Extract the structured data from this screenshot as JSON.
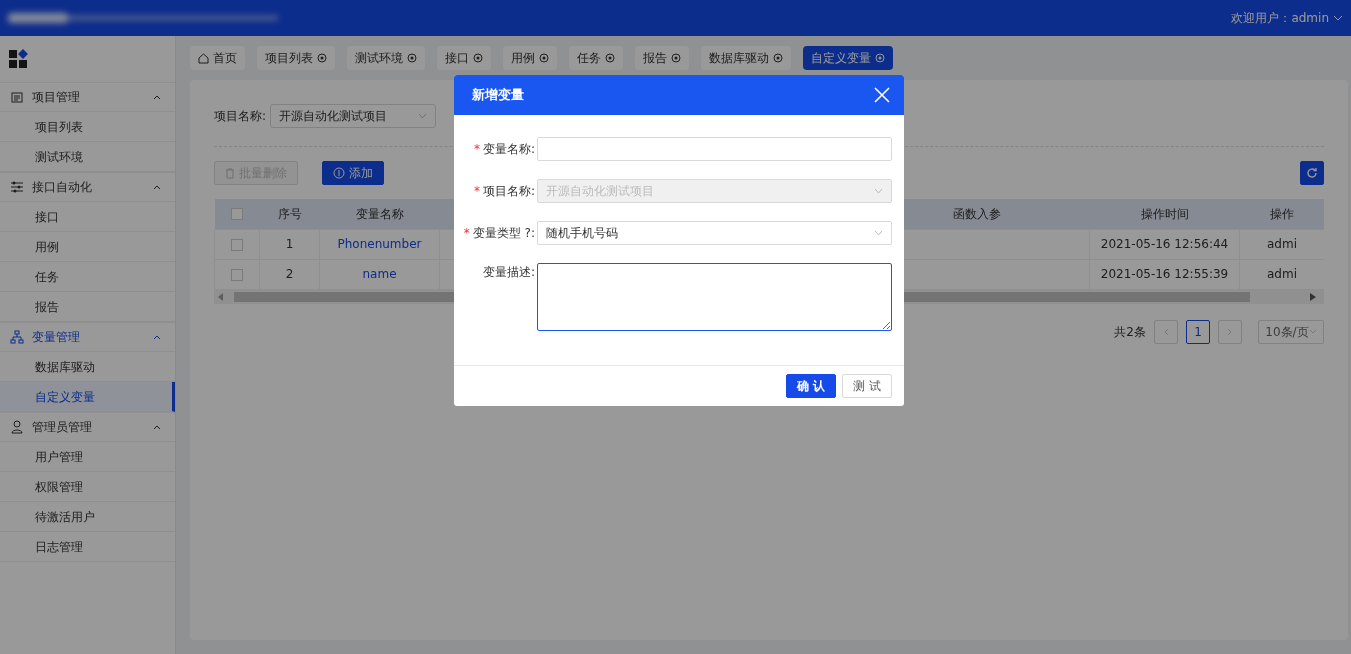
{
  "header": {
    "greeting": "欢迎用户：",
    "user": "admin"
  },
  "sidebar": {
    "groups": [
      {
        "label": "项目管理",
        "expanded": true,
        "active": false,
        "children": [
          {
            "label": "项目列表",
            "selected": false
          },
          {
            "label": "测试环境",
            "selected": false
          }
        ]
      },
      {
        "label": "接口自动化",
        "expanded": true,
        "active": false,
        "children": [
          {
            "label": "接口",
            "selected": false
          },
          {
            "label": "用例",
            "selected": false
          },
          {
            "label": "任务",
            "selected": false
          },
          {
            "label": "报告",
            "selected": false
          }
        ]
      },
      {
        "label": "变量管理",
        "expanded": true,
        "active": true,
        "children": [
          {
            "label": "数据库驱动",
            "selected": false
          },
          {
            "label": "自定义变量",
            "selected": true
          }
        ]
      },
      {
        "label": "管理员管理",
        "expanded": true,
        "active": false,
        "children": [
          {
            "label": "用户管理",
            "selected": false
          },
          {
            "label": "权限管理",
            "selected": false
          },
          {
            "label": "待激活用户",
            "selected": false
          },
          {
            "label": "日志管理",
            "selected": false
          }
        ]
      }
    ]
  },
  "tabs": [
    {
      "label": "首页",
      "closable": false,
      "selected": false
    },
    {
      "label": "项目列表",
      "closable": true,
      "selected": false
    },
    {
      "label": "测试环境",
      "closable": true,
      "selected": false
    },
    {
      "label": "接口",
      "closable": true,
      "selected": false
    },
    {
      "label": "用例",
      "closable": true,
      "selected": false
    },
    {
      "label": "任务",
      "closable": true,
      "selected": false
    },
    {
      "label": "报告",
      "closable": true,
      "selected": false
    },
    {
      "label": "数据库驱动",
      "closable": true,
      "selected": false
    },
    {
      "label": "自定义变量",
      "closable": true,
      "selected": true
    }
  ],
  "filter": {
    "label": "项目名称:",
    "value": "开源自动化测试项目"
  },
  "toolbar": [
    {
      "label": "批量删除",
      "kind": "delete",
      "disabled": true
    },
    {
      "label": "添加",
      "kind": "add",
      "disabled": false
    }
  ],
  "table": {
    "all_checked": false,
    "columns": [
      "序号",
      "变量名称",
      "",
      "函数入参",
      "操作时间",
      "操作"
    ],
    "rows": [
      {
        "checked": false,
        "cells": [
          "1",
          "Phonenumber",
          "",
          "",
          "2021-05-16 12:56:44",
          "admi"
        ]
      },
      {
        "checked": false,
        "cells": [
          "2",
          "name",
          "",
          "",
          "2021-05-16 12:55:39",
          "admi"
        ]
      }
    ]
  },
  "pagination": {
    "total": "共2条",
    "pages": [
      {
        "label": "1",
        "selected": true
      }
    ],
    "page_size": "10条/页"
  },
  "modal": {
    "title": "新增变量",
    "fields": [
      {
        "label": "变量名称:",
        "required_mark": "*",
        "kind": "text",
        "disabled": false
      },
      {
        "label": "项目名称:",
        "required_mark": "*",
        "kind": "select",
        "value": "开源自动化测试项目",
        "disabled": true
      },
      {
        "label": "变量类型 ?:",
        "required_mark": "*",
        "kind": "select",
        "value": "随机手机号码",
        "disabled": false
      },
      {
        "label": "变量描述:",
        "kind": "textarea",
        "disabled": false
      }
    ],
    "buttons": [
      {
        "label": "确 认",
        "primary": true
      },
      {
        "label": "测 试",
        "primary": false
      }
    ]
  }
}
